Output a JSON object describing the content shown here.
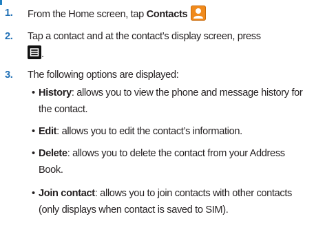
{
  "steps": [
    {
      "number": "1.",
      "text_before": "From the Home screen, tap ",
      "bold": "Contacts",
      "icon": "contacts-app-icon"
    },
    {
      "number": "2.",
      "line1": "Tap a contact and at the contact’s display screen, press",
      "line2_suffix": ".",
      "icon": "menu-key-icon"
    },
    {
      "number": "3.",
      "text": "The following options are displayed:"
    }
  ],
  "options": [
    {
      "term": "History",
      "line1": ": allows you to view the phone and message history for",
      "line2": "the contact."
    },
    {
      "term": "Edit",
      "line1": ": allows you to edit the contact’s information."
    },
    {
      "term": "Delete",
      "line1": ": allows you to delete the contact from your Address",
      "line2": "Book."
    },
    {
      "term": "Join contact",
      "line1": ": allows you to join contacts with other contacts",
      "line2": "(only displays when contact is saved to SIM)."
    }
  ],
  "bullet_char": "•",
  "colors": {
    "step_number": "#1f6fb5",
    "text": "#231f20",
    "contacts_icon": "#f08a1c"
  }
}
